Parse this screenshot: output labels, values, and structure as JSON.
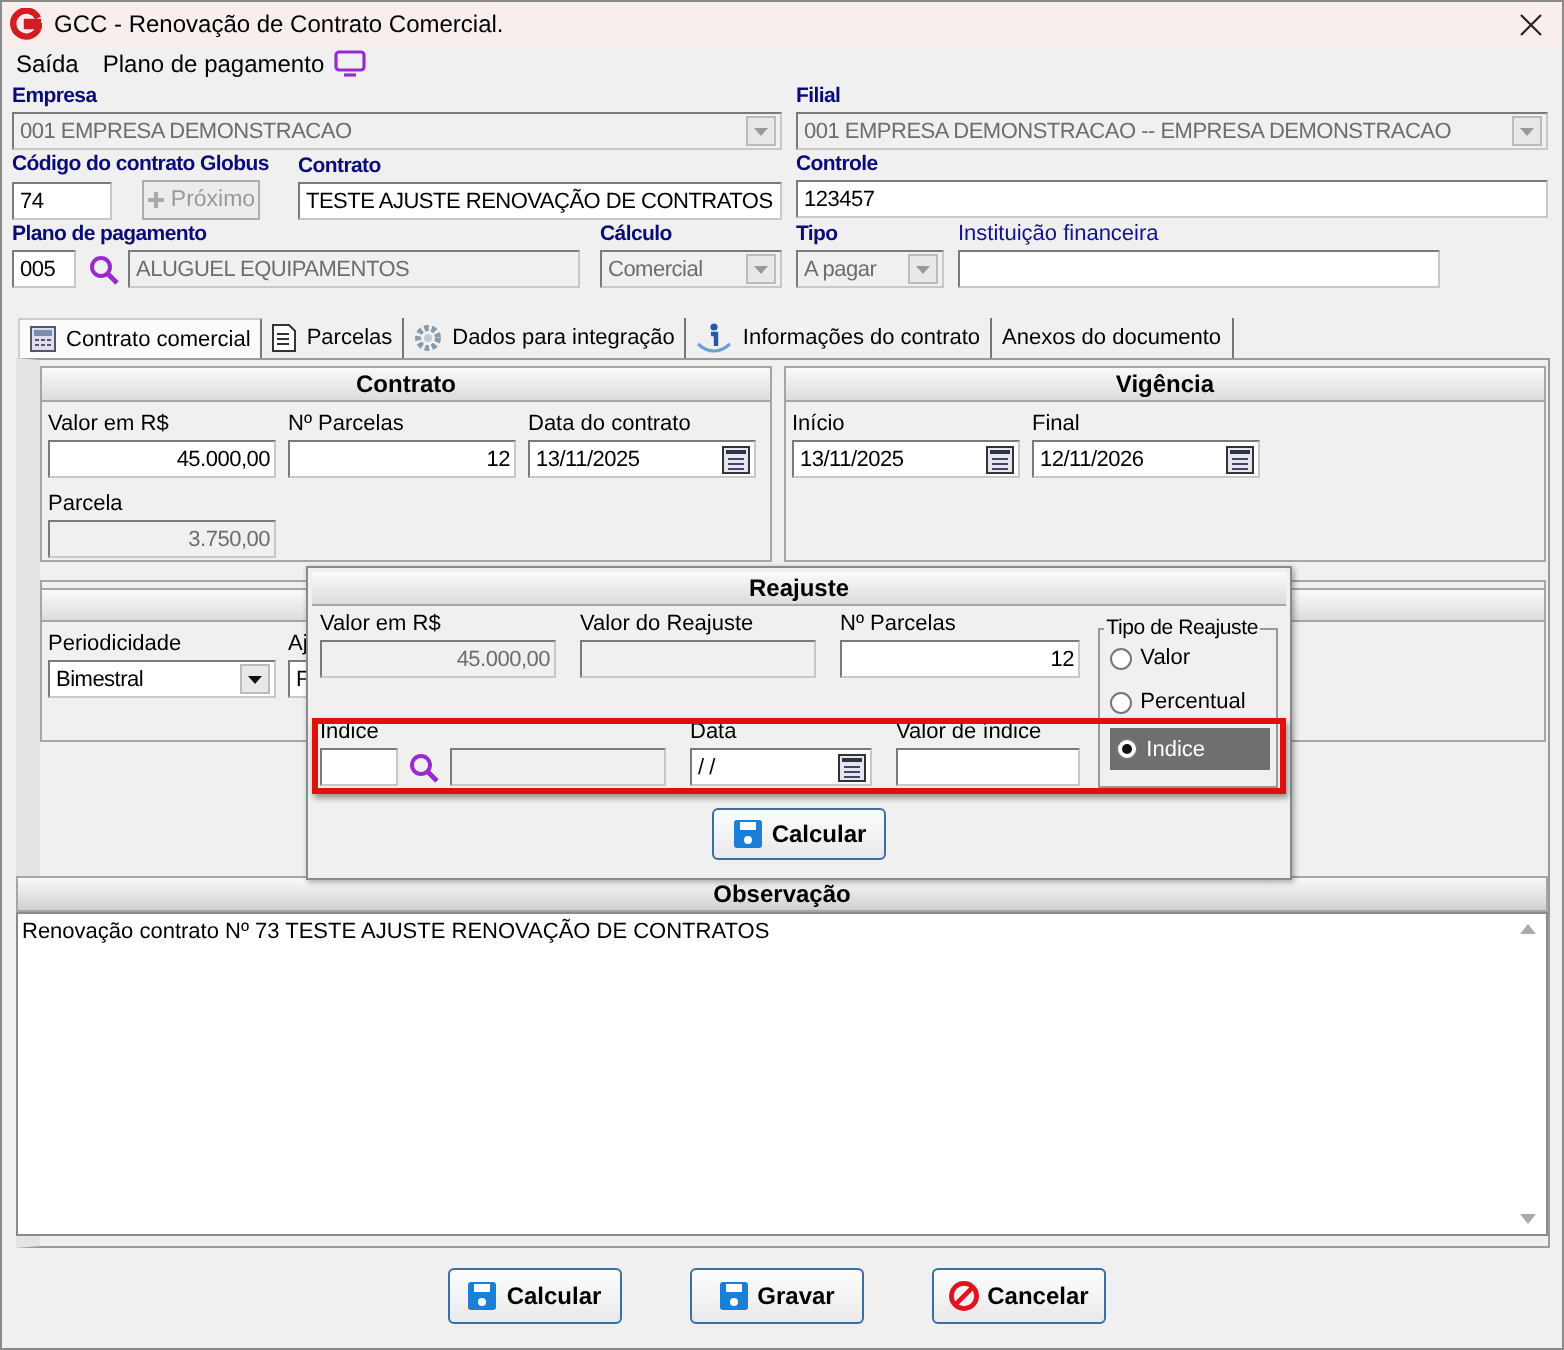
{
  "window": {
    "title": "GCC - Renovação de Contrato Comercial."
  },
  "menu": [
    {
      "label": "Saída"
    },
    {
      "label": "Plano de pagamento"
    }
  ],
  "header": {
    "empresa": {
      "label": "Empresa",
      "value": "001 EMPRESA DEMONSTRACAO",
      "disabled": true
    },
    "filial": {
      "label": "Filial",
      "value": "001 EMPRESA DEMONSTRACAO -- EMPRESA DEMONSTRACAO",
      "disabled": true
    },
    "codigo": {
      "label": "Código do contrato Globus",
      "value": "74"
    },
    "proximo": {
      "label": "Próximo",
      "disabled": true
    },
    "contrato": {
      "label": "Contrato",
      "value": "TESTE AJUSTE RENOVAÇÃO DE CONTRATOS"
    },
    "controle": {
      "label": "Controle",
      "value": "123457"
    },
    "plano": {
      "label": "Plano de pagamento",
      "code": "005",
      "description": "ALUGUEL EQUIPAMENTOS"
    },
    "calculo": {
      "label": "Cálculo",
      "value": "Comercial",
      "disabled": true
    },
    "tipo": {
      "label": "Tipo",
      "value": "A pagar",
      "disabled": true
    },
    "instituicao": {
      "label": "Instituição financeira"
    }
  },
  "tabs": [
    {
      "label": "Contrato comercial",
      "kind": "calculator",
      "selected": true
    },
    {
      "label": "Parcelas",
      "kind": "document",
      "selected": false
    },
    {
      "label": "Dados para integração",
      "kind": "gear",
      "selected": false
    },
    {
      "label": "Informações do contrato",
      "kind": "info",
      "selected": false
    },
    {
      "label": "Anexos do documento",
      "kind": "plain",
      "selected": false
    }
  ],
  "contrato": {
    "title": "Contrato",
    "valor_label": "Valor em R$",
    "valor": "45.000,00",
    "parcelas_label": "Nº Parcelas",
    "parcelas": "12",
    "data_label": "Data do contrato",
    "data": "13/11/2025",
    "parcela_label": "Parcela",
    "parcela": "3.750,00"
  },
  "vigencia": {
    "title": "Vigência",
    "inicio_label": "Início",
    "inicio": "13/11/2025",
    "final_label": "Final",
    "final": "12/11/2026"
  },
  "periodicidade": {
    "label": "Periodicidade",
    "value": "Bimestral",
    "column_2_label": "Aj",
    "column_2_value": "F"
  },
  "reajuste": {
    "title": "Reajuste",
    "valor_label": "Valor em R$",
    "valor": "45.000,00",
    "valor_reajuste_label": "Valor do Reajuste",
    "parcelas_label": "Nº Parcelas",
    "parcelas": "12",
    "tipo_title": "Tipo de Reajuste",
    "tipo_options": [
      {
        "label": "Valor",
        "selected": false
      },
      {
        "label": "Percentual",
        "selected": false
      },
      {
        "label": "Indice",
        "selected": true
      }
    ],
    "indice_label": "Indice",
    "data_label": "Data",
    "data": "/ /",
    "valor_indice_label": "Valor de índice",
    "highlighted": true,
    "button": "Calcular"
  },
  "observacao": {
    "title": "Observação",
    "text": "Renovação contrato Nº 73 TESTE AJUSTE RENOVAÇÃO DE CONTRATOS"
  },
  "buttons": [
    {
      "label": "Calcular",
      "kind": "save"
    },
    {
      "label": "Gravar",
      "kind": "save"
    },
    {
      "label": "Cancelar",
      "kind": "cancel"
    }
  ]
}
